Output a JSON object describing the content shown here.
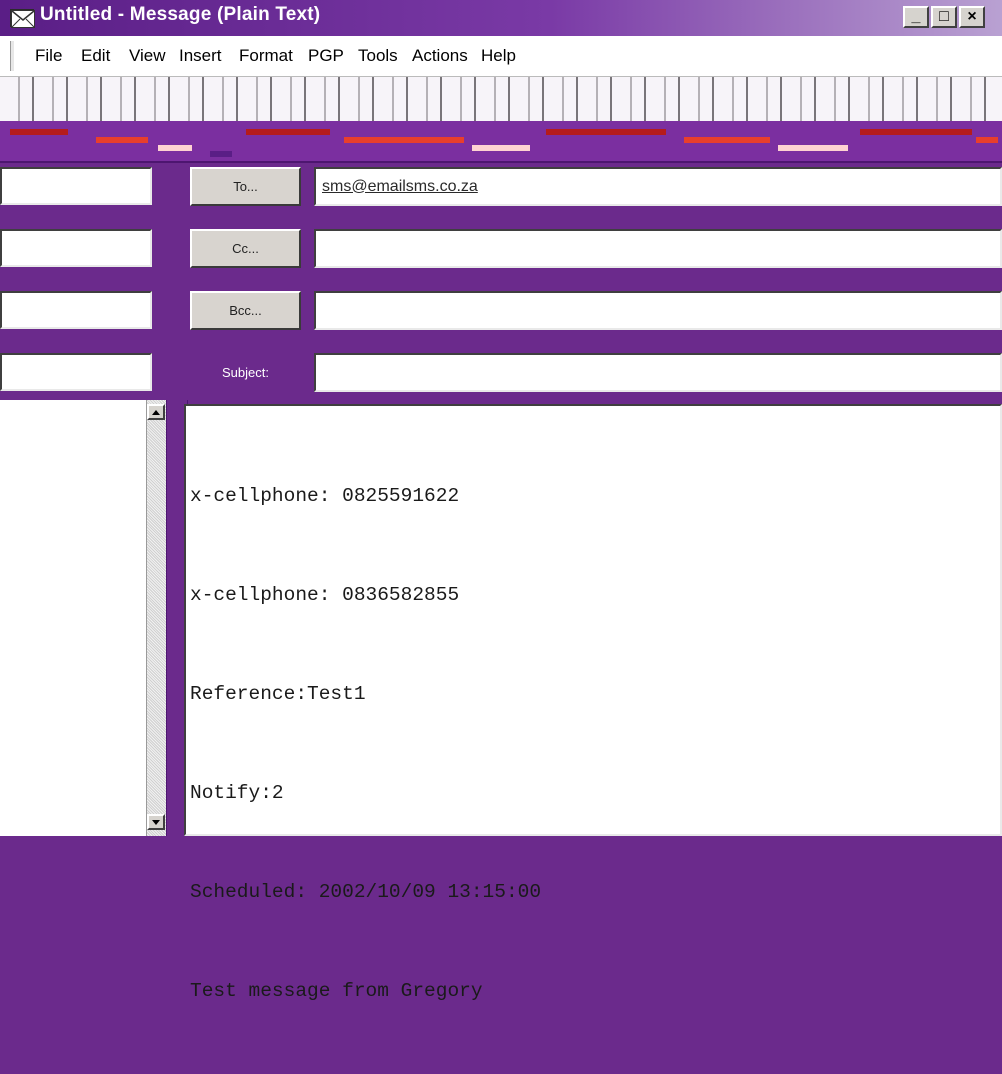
{
  "window": {
    "title": "Untitled - Message (Plain Text)",
    "buttons": [
      "_",
      "□",
      "×"
    ]
  },
  "menu": {
    "items": [
      "File",
      "Edit",
      "View",
      "Insert",
      "Format",
      "PGP",
      "Tools",
      "Actions",
      "Help"
    ]
  },
  "header": {
    "to_button": "To...",
    "cc_button": "Cc...",
    "bcc_button": "Bcc...",
    "subject_label": "Subject:",
    "to_value": "sms@emailsms.co.za",
    "cc_value": "",
    "bcc_value": "",
    "subject_value": ""
  },
  "body": {
    "lines": [
      "x-cellphone: 0825591622",
      "x-cellphone: 0836582855",
      "Reference:Test1",
      "Notify:2",
      "Scheduled: 2002/10/09 13:15:00",
      "Test message from Gregory"
    ]
  },
  "colors": {
    "chrome_purple": "#6b2a8c",
    "title_start": "#5a1e86",
    "title_end": "#b9a1d2"
  },
  "icons": {
    "app": "envelope-icon",
    "minimize": "minimize-icon",
    "maximize": "maximize-icon",
    "close": "close-icon"
  }
}
